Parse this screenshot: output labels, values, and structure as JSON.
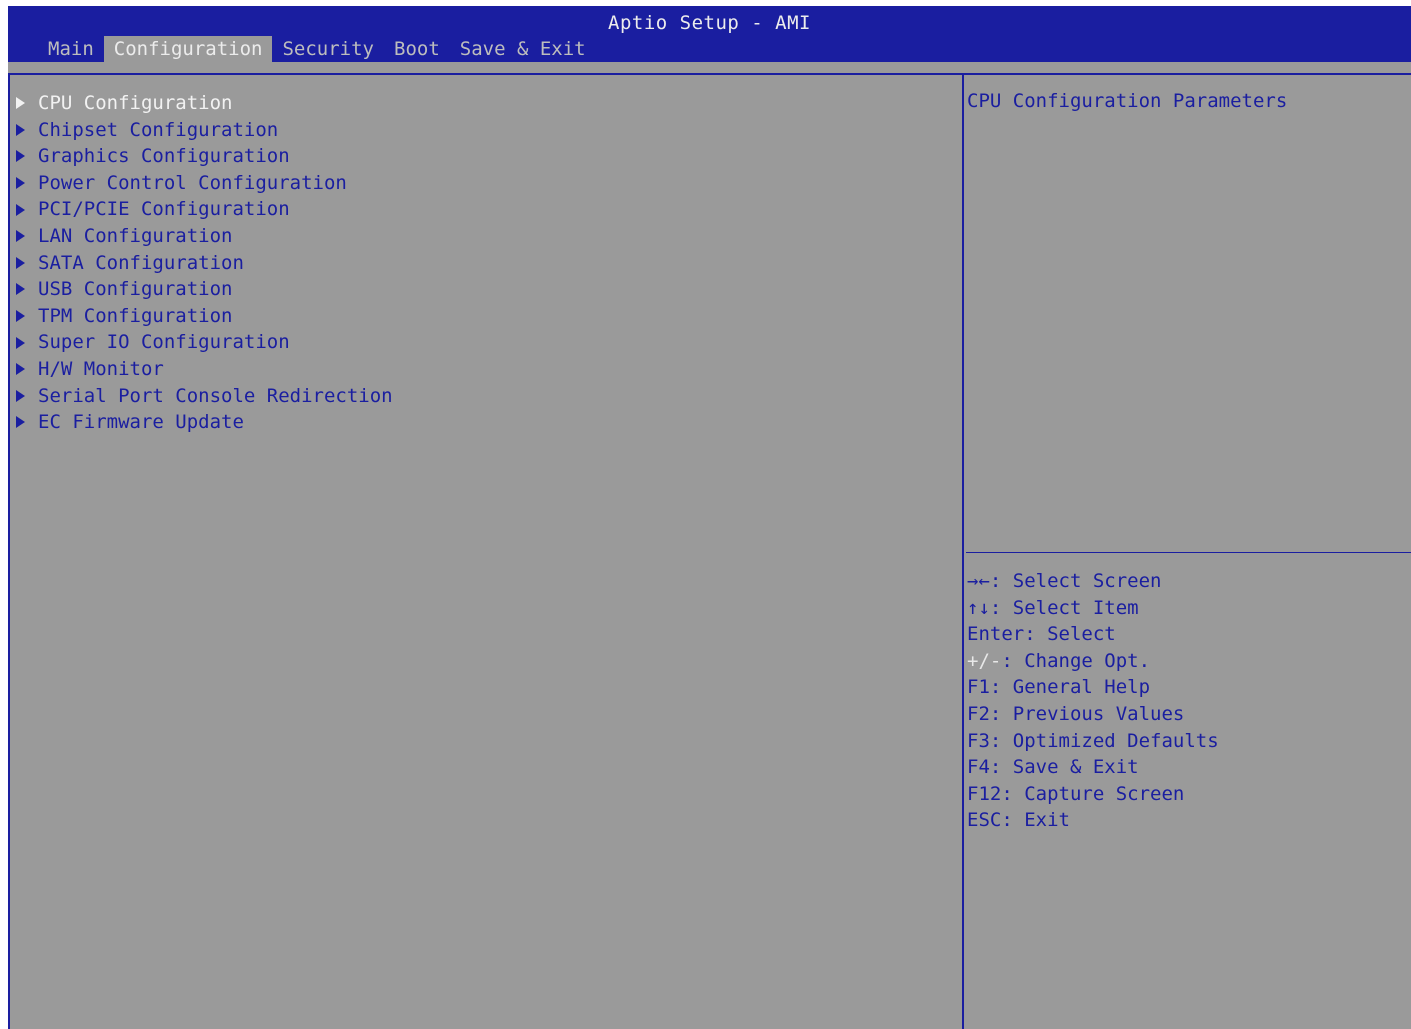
{
  "app": {
    "title": "Aptio Setup - AMI"
  },
  "tabs": [
    {
      "label": "Main",
      "active": false
    },
    {
      "label": "Configuration",
      "active": true
    },
    {
      "label": "Security",
      "active": false
    },
    {
      "label": "Boot",
      "active": false
    },
    {
      "label": "Save & Exit",
      "active": false
    }
  ],
  "menu": {
    "items": [
      {
        "label": "CPU Configuration",
        "selected": true
      },
      {
        "label": "Chipset Configuration"
      },
      {
        "label": "Graphics Configuration"
      },
      {
        "label": "Power Control Configuration"
      },
      {
        "label": "PCI/PCIE Configuration"
      },
      {
        "label": "LAN Configuration"
      },
      {
        "label": "SATA Configuration"
      },
      {
        "label": "USB Configuration"
      },
      {
        "label": "TPM Configuration"
      },
      {
        "label": "Super IO Configuration"
      },
      {
        "label": "H/W Monitor"
      },
      {
        "label": "Serial Port Console Redirection"
      },
      {
        "label": "EC Firmware Update"
      }
    ],
    "item_icon": "triangle-right-icon"
  },
  "help": {
    "text": "CPU Configuration Parameters"
  },
  "keys": [
    {
      "key": "→←",
      "desc": ": Select Screen"
    },
    {
      "key": "↑↓",
      "desc": ": Select Item"
    },
    {
      "key": "Enter",
      "desc": ": Select"
    },
    {
      "key": "+/-",
      "desc": ": Change Opt."
    },
    {
      "key": "F1",
      "desc": ": General Help"
    },
    {
      "key": "F2",
      "desc": ": Previous Values"
    },
    {
      "key": "F3",
      "desc": ": Optimized Defaults"
    },
    {
      "key": "F4",
      "desc": ": Save & Exit"
    },
    {
      "key": "F12",
      "desc": ": Capture Screen"
    },
    {
      "key": "ESC",
      "desc": ": Exit"
    }
  ],
  "colors": {
    "header_bg": "#1a1ea0",
    "panel_bg": "#9a9a9a",
    "text_blue": "#1a1ea0",
    "text_selected": "#f2f2f2"
  }
}
